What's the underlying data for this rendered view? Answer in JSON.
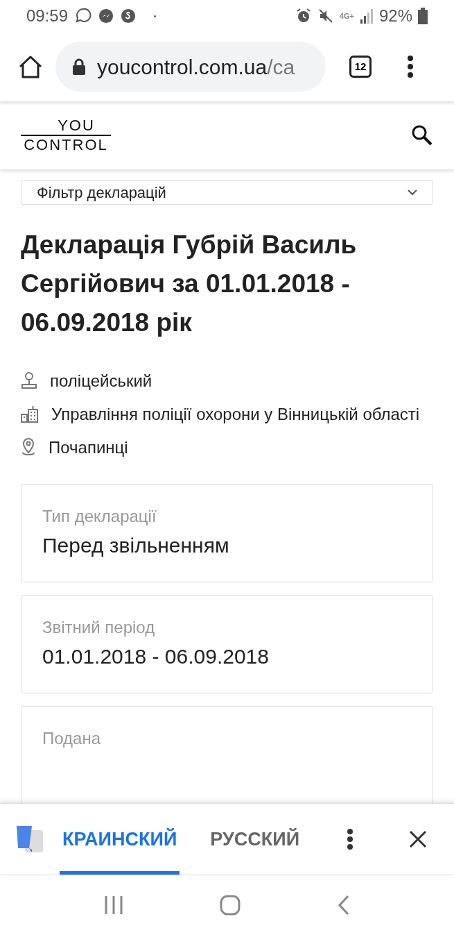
{
  "status_bar": {
    "time": "09:59",
    "network": "4G+",
    "battery": "92%"
  },
  "browser": {
    "url_host": "youcontrol.com.ua",
    "url_path": "/ca",
    "tab_count": "12"
  },
  "site_header": {
    "logo_top": "YOU",
    "logo_bottom": "CONTROL"
  },
  "filter": {
    "label": "Фільтр декларацій"
  },
  "title": "Декларація Губрій Василь Сергійович за 01.01.2018 - 06.09.2018 рік",
  "facts": [
    {
      "kind": "position",
      "text": "поліцейський"
    },
    {
      "kind": "organization",
      "text": "Управління поліції охорони у Вінницькій області"
    },
    {
      "kind": "location",
      "text": "Почапинці"
    }
  ],
  "cards": [
    {
      "label": "Тип декларації",
      "value": "Перед звільненням"
    },
    {
      "label": "Звітний період",
      "value": "01.01.2018 - 06.09.2018"
    },
    {
      "label": "Подана"
    }
  ],
  "translate_bar": {
    "tabs": [
      {
        "label": "КРАИНСКИЙ",
        "selected": true
      },
      {
        "label": "РУССКИЙ",
        "selected": false
      }
    ]
  }
}
